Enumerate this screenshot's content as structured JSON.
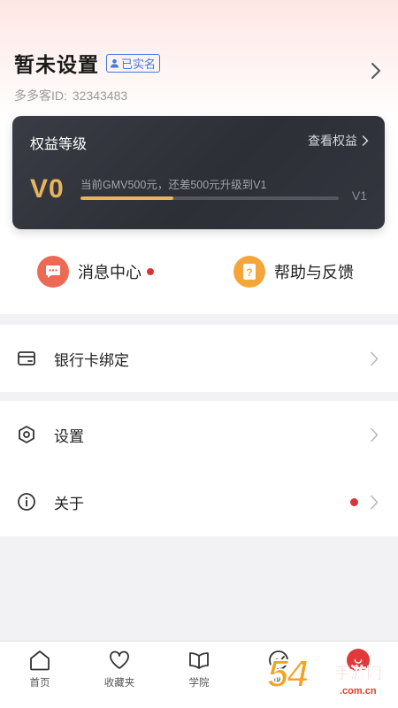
{
  "profile": {
    "username": "暂未设置",
    "verified_label": "已实名",
    "id_label": "多多客ID:",
    "id_value": "32343483"
  },
  "level_card": {
    "title": "权益等级",
    "link_label": "查看权益",
    "current_level": "V0",
    "progress_text": "当前GMV500元，还差500元升级到V1",
    "next_level": "V1",
    "progress_fraction": 0.36,
    "accent_color": "#e9b45e"
  },
  "quick_actions": [
    {
      "label": "消息中心",
      "icon": "message-icon",
      "has_dot": true
    },
    {
      "label": "帮助与反馈",
      "icon": "help-icon"
    }
  ],
  "menu": {
    "bank": {
      "label": "银行卡绑定",
      "icon": "bank-card-icon"
    },
    "settings": {
      "label": "设置",
      "icon": "hexagon-settings-icon"
    },
    "about": {
      "label": "关于",
      "icon": "info-icon",
      "has_dot": true
    }
  },
  "tabbar": {
    "home": "首页",
    "favorites": "收藏夹",
    "school": "学院",
    "income": "收",
    "mine": ""
  },
  "watermark": {
    "number": "54",
    "title": "手游网",
    "url": ".com.cn"
  }
}
